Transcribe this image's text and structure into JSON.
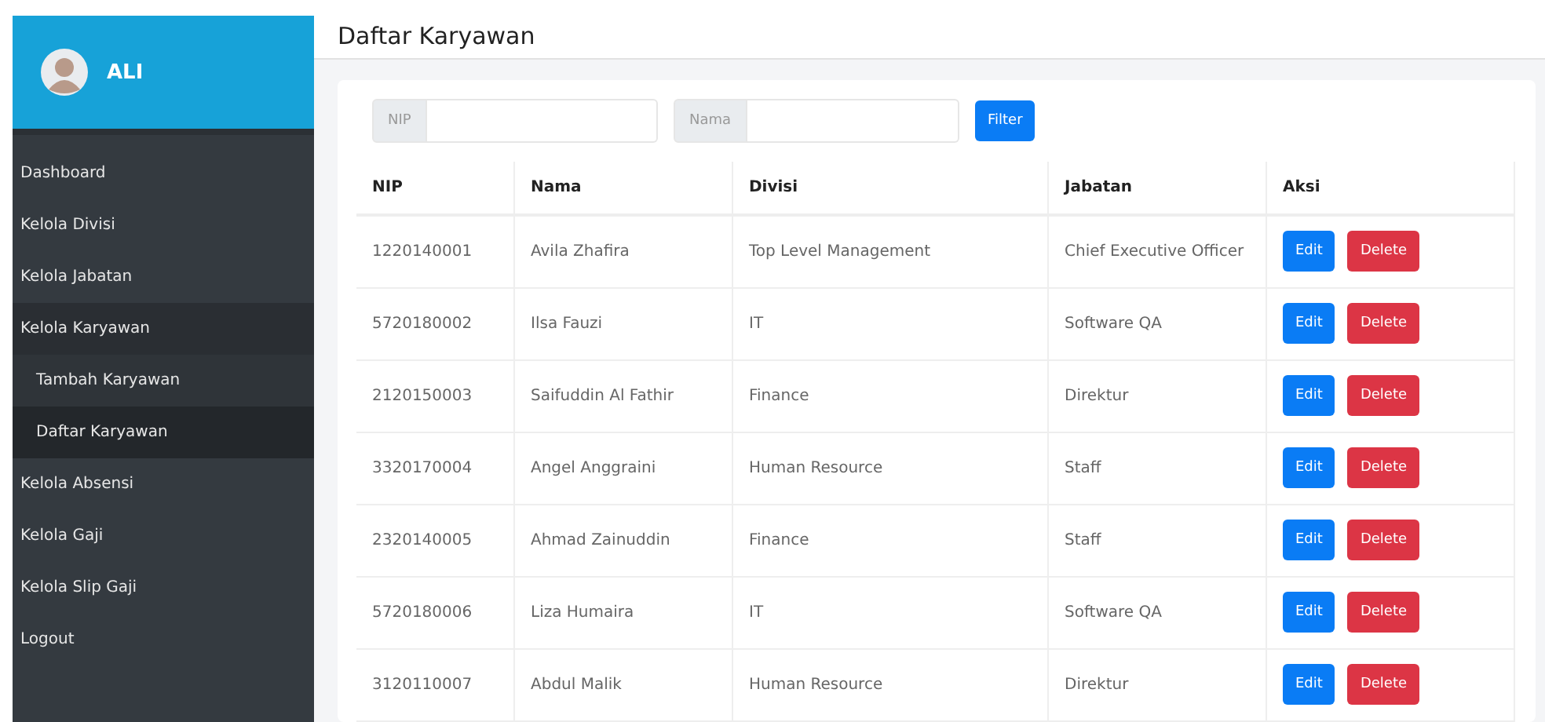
{
  "sidebar": {
    "user": {
      "name": "ALI"
    },
    "items": [
      {
        "label": "Dashboard",
        "selected": false
      },
      {
        "label": "Kelola Divisi",
        "selected": false
      },
      {
        "label": "Kelola Jabatan",
        "selected": false
      },
      {
        "label": "Kelola Karyawan",
        "selected": false,
        "expanded": true,
        "children": [
          {
            "label": "Tambah Karyawan",
            "selected": false
          },
          {
            "label": "Daftar Karyawan",
            "selected": true
          }
        ]
      },
      {
        "label": "Kelola Absensi",
        "selected": false
      },
      {
        "label": "Kelola Gaji",
        "selected": false
      },
      {
        "label": "Kelola Slip Gaji",
        "selected": false
      },
      {
        "label": "Logout",
        "selected": false
      }
    ]
  },
  "page_title": "Daftar Karyawan",
  "filter": {
    "fields": [
      {
        "label": "NIP"
      },
      {
        "label": "Nama"
      }
    ],
    "button": "Filter"
  },
  "table": {
    "columns": [
      "NIP",
      "Nama",
      "Divisi",
      "Jabatan",
      "Aksi"
    ],
    "rows": [
      {
        "nip": "1220140001",
        "nama": "Avila Zhafira",
        "divisi": "Top Level Management",
        "jabatan": "Chief Executive Officer",
        "actions": [
          "Edit",
          "Delete"
        ]
      },
      {
        "nip": "5720180002",
        "nama": "Ilsa Fauzi",
        "divisi": "IT",
        "jabatan": "Software QA",
        "actions": [
          "Edit",
          "Delete"
        ]
      },
      {
        "nip": "2120150003",
        "nama": "Saifuddin Al Fathir",
        "divisi": "Finance",
        "jabatan": "Direktur",
        "actions": [
          "Edit",
          "Delete"
        ]
      },
      {
        "nip": "3320170004",
        "nama": "Angel Anggraini",
        "divisi": "Human Resource",
        "jabatan": "Staff",
        "actions": [
          "Edit",
          "Delete"
        ]
      },
      {
        "nip": "2320140005",
        "nama": "Ahmad Zainuddin",
        "divisi": "Finance",
        "jabatan": "Staff",
        "actions": [
          "Edit",
          "Delete"
        ]
      },
      {
        "nip": "5720180006",
        "nama": "Liza Humaira",
        "divisi": "IT",
        "jabatan": "Software QA",
        "actions": [
          "Edit",
          "Delete"
        ]
      },
      {
        "nip": "3120110007",
        "nama": "Abdul Malik",
        "divisi": "Human Resource",
        "jabatan": "Direktur",
        "actions": [
          "Edit",
          "Delete"
        ]
      }
    ]
  }
}
